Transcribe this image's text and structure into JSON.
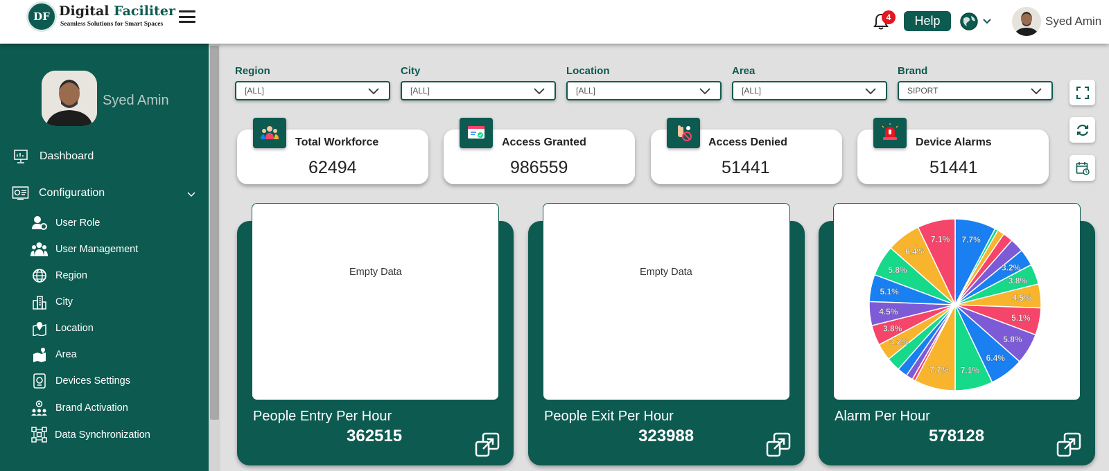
{
  "brand": {
    "logo_text": "DF",
    "name_part1": "Digital",
    "name_part2": "Faciliter",
    "tagline": "Seamless Solutions for Smart Spaces"
  },
  "header": {
    "notification_count": "4",
    "help_label": "Help",
    "user_name": "Syed Amin"
  },
  "sidebar": {
    "user_name": "Syed Amin",
    "items": [
      {
        "label": "Dashboard",
        "icon": "dashboard-icon"
      },
      {
        "label": "Configuration",
        "icon": "configuration-icon"
      }
    ],
    "sub_items": [
      {
        "label": "User Role",
        "icon": "user-role-icon"
      },
      {
        "label": "User Management",
        "icon": "user-management-icon"
      },
      {
        "label": "Region",
        "icon": "region-icon"
      },
      {
        "label": "City",
        "icon": "city-icon"
      },
      {
        "label": "Location",
        "icon": "location-icon"
      },
      {
        "label": "Area",
        "icon": "area-icon"
      },
      {
        "label": "Devices Settings",
        "icon": "devices-settings-icon"
      },
      {
        "label": "Brand Activation",
        "icon": "brand-activation-icon"
      },
      {
        "label": "Data Synchronization",
        "icon": "data-sync-icon"
      }
    ]
  },
  "filters": [
    {
      "label": "Region",
      "value": "[ALL]"
    },
    {
      "label": "City",
      "value": "[ALL]"
    },
    {
      "label": "Location",
      "value": "[ALL]"
    },
    {
      "label": "Area",
      "value": "[ALL]"
    },
    {
      "label": "Brand",
      "value": "SIPORT"
    }
  ],
  "stats": [
    {
      "title": "Total Workforce",
      "value": "62494",
      "icon": "workforce-icon"
    },
    {
      "title": "Access Granted",
      "value": "986559",
      "icon": "access-granted-icon"
    },
    {
      "title": "Access Denied",
      "value": "51441",
      "icon": "access-denied-icon"
    },
    {
      "title": "Device Alarms",
      "value": "51441",
      "icon": "alarm-icon"
    }
  ],
  "panels": [
    {
      "title": "People Entry Per Hour",
      "value": "362515",
      "empty_text": "Empty Data"
    },
    {
      "title": "People Exit Per Hour",
      "value": "323988",
      "empty_text": "Empty Data"
    },
    {
      "title": "Alarm Per Hour",
      "value": "578128"
    }
  ],
  "colors": {
    "primary": "#0d5a50",
    "badge": "#e3171f",
    "pie": [
      "#1a7ff0",
      "#f8b42c",
      "#f5456a",
      "#7e5bd6",
      "#16d98a"
    ]
  },
  "chart_data": {
    "type": "pie",
    "title": "",
    "start_angle_deg": 0,
    "direction": "clockwise",
    "slices": [
      {
        "value": 7.7,
        "label": "7.7%",
        "color": "#1a7ff0"
      },
      {
        "value": 0.6,
        "label": "",
        "color": "#16d98a"
      },
      {
        "value": 1.3,
        "label": "",
        "color": "#f8b42c"
      },
      {
        "value": 1.9,
        "label": "",
        "color": "#f5456a"
      },
      {
        "value": 2.6,
        "label": "",
        "color": "#7e5bd6"
      },
      {
        "value": 3.2,
        "label": "3.2%",
        "color": "#1a7ff0"
      },
      {
        "value": 3.8,
        "label": "3.8%",
        "color": "#16d98a"
      },
      {
        "value": 4.5,
        "label": "4.5%",
        "color": "#f8b42c"
      },
      {
        "value": 5.1,
        "label": "5.1%",
        "color": "#f5456a"
      },
      {
        "value": 5.8,
        "label": "5.8%",
        "color": "#7e5bd6"
      },
      {
        "value": 6.4,
        "label": "6.4%",
        "color": "#1a7ff0"
      },
      {
        "value": 7.1,
        "label": "7.1%",
        "color": "#16d98a"
      },
      {
        "value": 7.7,
        "label": "7.7%",
        "color": "#f8b42c"
      },
      {
        "value": 0.6,
        "label": "",
        "color": "#f5456a"
      },
      {
        "value": 1.3,
        "label": "",
        "color": "#7e5bd6"
      },
      {
        "value": 1.9,
        "label": "",
        "color": "#1a7ff0"
      },
      {
        "value": 2.6,
        "label": "",
        "color": "#16d98a"
      },
      {
        "value": 3.2,
        "label": "3.2%",
        "color": "#f8b42c"
      },
      {
        "value": 3.8,
        "label": "3.8%",
        "color": "#f5456a"
      },
      {
        "value": 4.5,
        "label": "4.5%",
        "color": "#7e5bd6"
      },
      {
        "value": 5.1,
        "label": "5.1%",
        "color": "#1a7ff0"
      },
      {
        "value": 5.8,
        "label": "5.8%",
        "color": "#16d98a"
      },
      {
        "value": 6.4,
        "label": "6.4%",
        "color": "#f8b42c"
      },
      {
        "value": 7.1,
        "label": "7.1%",
        "color": "#f5456a"
      }
    ]
  }
}
